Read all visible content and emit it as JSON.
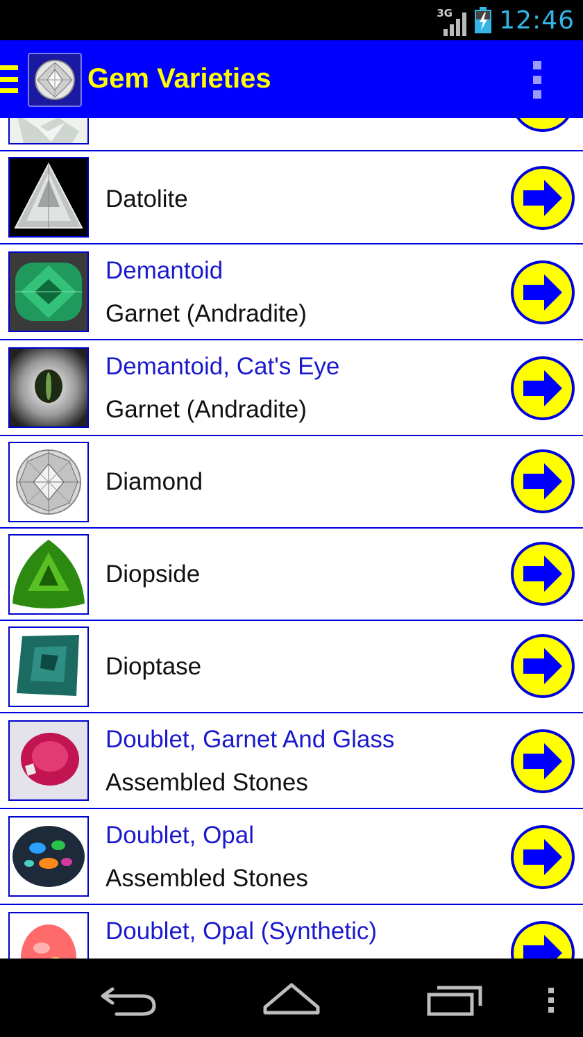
{
  "status_bar": {
    "network": "3G",
    "time": "12:46"
  },
  "app_bar": {
    "title": "Gem Varieties",
    "menu_icon": "hamburger-menu-icon",
    "app_icon": "diamond-logo-icon",
    "overflow_icon": "overflow-menu-icon"
  },
  "list": {
    "items": [
      {
        "name": "",
        "category": "",
        "partial": true
      },
      {
        "name": "Datolite",
        "category": ""
      },
      {
        "name": "Demantoid",
        "category": "Garnet (Andradite)"
      },
      {
        "name": "Demantoid, Cat's Eye",
        "category": "Garnet (Andradite)"
      },
      {
        "name": "Diamond",
        "category": ""
      },
      {
        "name": "Diopside",
        "category": ""
      },
      {
        "name": "Dioptase",
        "category": ""
      },
      {
        "name": "Doublet, Garnet And Glass",
        "category": "Assembled Stones"
      },
      {
        "name": "Doublet, Opal",
        "category": "Assembled Stones"
      },
      {
        "name": "Doublet, Opal (Synthetic)",
        "category": ""
      }
    ],
    "arrow_icon": "arrow-right-circle-icon"
  },
  "colors": {
    "app_bar": "#0000ff",
    "title_text": "#ffff00",
    "link_text": "#1a1acc",
    "divider": "#0000dd",
    "arrow_circle": "#ffff00",
    "arrow": "#0000ff"
  },
  "nav_bar": {
    "back_icon": "back-icon",
    "home_icon": "home-icon",
    "recents_icon": "recent-apps-icon",
    "menu_icon": "overflow-menu-icon"
  }
}
